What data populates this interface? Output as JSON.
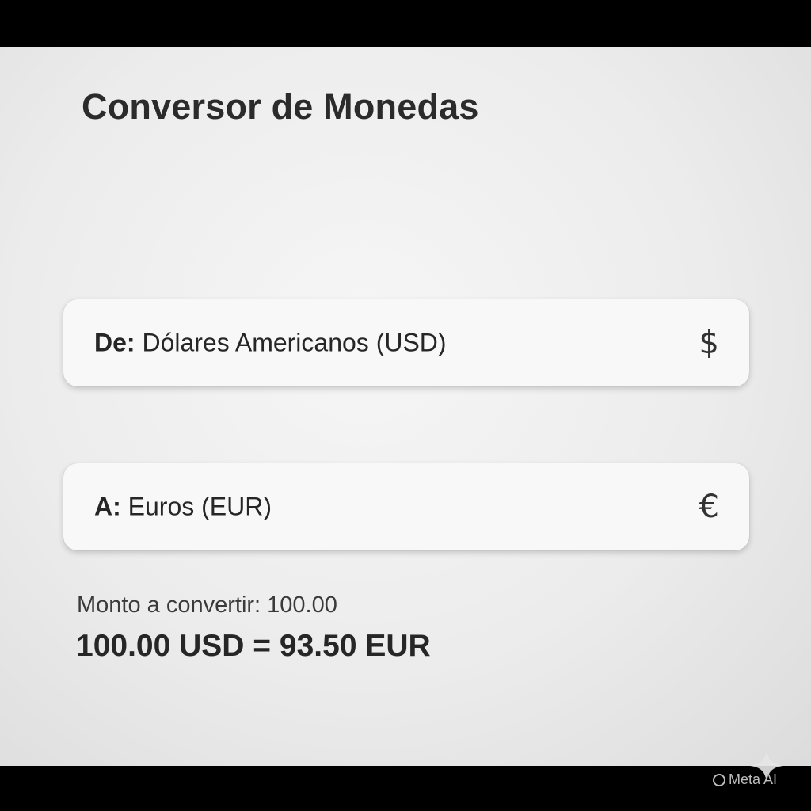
{
  "app": {
    "title": "Conversor de Monedas"
  },
  "from_select": {
    "prefix": "De:",
    "value": "Dólares Americanos (USD)",
    "icon": "dollar-icon",
    "symbol": "$"
  },
  "to_select": {
    "prefix": "A:",
    "value": "Euros (EUR)",
    "icon": "euro-icon",
    "symbol": "€"
  },
  "conversion": {
    "amount_text": "Monto a convertir: 100.00",
    "result_text": "100.00 USD = 93.50 EUR"
  },
  "watermark": {
    "text": "Meta AI"
  }
}
